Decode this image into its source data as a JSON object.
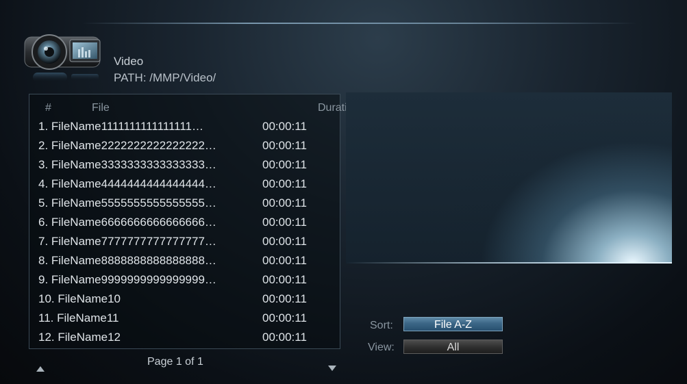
{
  "header": {
    "title": "Video",
    "path": "PATH: /MMP/Video/",
    "icon": "video-camera-icon"
  },
  "list": {
    "columns": {
      "index": "#",
      "file": "File",
      "duration": "Duration"
    },
    "rows": [
      {
        "name": "1. FileName1111111111111111…",
        "duration": "00:00:11"
      },
      {
        "name": "2. FileName2222222222222222…",
        "duration": "00:00:11"
      },
      {
        "name": "3. FileName3333333333333333…",
        "duration": "00:00:11"
      },
      {
        "name": "4. FileName4444444444444444…",
        "duration": "00:00:11"
      },
      {
        "name": "5. FileName5555555555555555…",
        "duration": "00:00:11"
      },
      {
        "name": "6. FileName6666666666666666…",
        "duration": "00:00:11"
      },
      {
        "name": "7. FileName7777777777777777…",
        "duration": "00:00:11"
      },
      {
        "name": "8. FileName8888888888888888…",
        "duration": "00:00:11"
      },
      {
        "name": "9. FileName9999999999999999…",
        "duration": "00:00:11"
      },
      {
        "name": "10. FileName10",
        "duration": "00:00:11"
      },
      {
        "name": "11. FileName11",
        "duration": "00:00:11"
      },
      {
        "name": "12. FileName12",
        "duration": "00:00:11"
      }
    ],
    "page_label": "Page 1 of 1"
  },
  "controls": {
    "sort_label": "Sort:",
    "sort_value": "File A-Z",
    "view_label": "View:",
    "view_value": "All"
  },
  "colors": {
    "accent": "#3b6686",
    "text": "#dfe4e8",
    "muted": "#8a96a0"
  }
}
